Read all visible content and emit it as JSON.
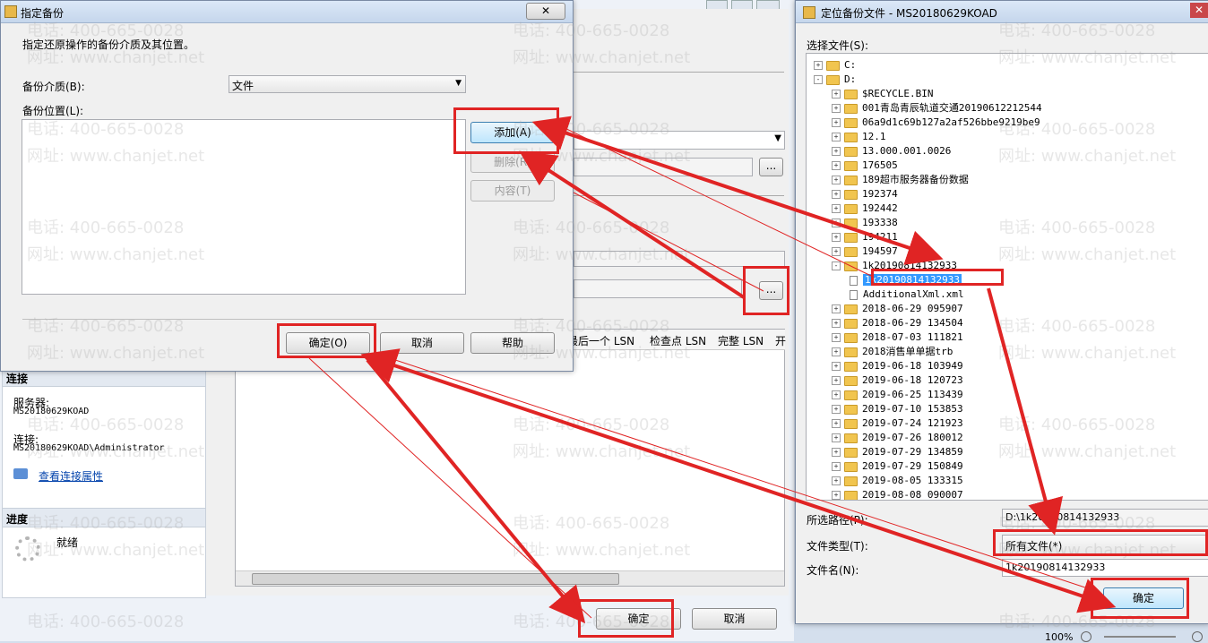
{
  "main_window": {
    "columns": [
      "最后一个 LSN",
      "检查点 LSN",
      "完整 LSN",
      "开"
    ],
    "connection_header": "连接",
    "server_label": "服务器:",
    "server_value": "MS20180629KOAD",
    "conn_label": "连接:",
    "conn_value": "MS20180629KOAD\\Administrator",
    "view_props_link": "查看连接属性",
    "progress_header": "进度",
    "progress_status": "就绪",
    "ok_label": "确定",
    "cancel_label": "取消",
    "browse_label": "..."
  },
  "dialog_specify": {
    "title": "指定备份",
    "instruction": "指定还原操作的备份介质及其位置。",
    "media_label": "备份介质(B):",
    "media_value": "文件",
    "location_label": "备份位置(L):",
    "add_label": "添加(A)",
    "remove_label": "删除(R)",
    "contents_label": "内容(T)",
    "ok_label": "确定(O)",
    "cancel_label": "取消",
    "help_label": "帮助"
  },
  "dialog_locate": {
    "title": "定位备份文件 - MS20180629KOAD",
    "select_label": "选择文件(S):",
    "tree": [
      {
        "indent": 0,
        "exp": "+",
        "type": "folder",
        "name": "C:"
      },
      {
        "indent": 0,
        "exp": "-",
        "type": "folder",
        "name": "D:"
      },
      {
        "indent": 1,
        "exp": "+",
        "type": "folder",
        "name": "$RECYCLE.BIN"
      },
      {
        "indent": 1,
        "exp": "+",
        "type": "folder",
        "name": "001青岛青辰轨道交通20190612212544"
      },
      {
        "indent": 1,
        "exp": "+",
        "type": "folder",
        "name": "06a9d1c69b127a2af526bbe9219be9"
      },
      {
        "indent": 1,
        "exp": "+",
        "type": "folder",
        "name": "12.1"
      },
      {
        "indent": 1,
        "exp": "+",
        "type": "folder",
        "name": "13.000.001.0026"
      },
      {
        "indent": 1,
        "exp": "+",
        "type": "folder",
        "name": "176505"
      },
      {
        "indent": 1,
        "exp": "+",
        "type": "folder",
        "name": "189超市服务器备份数据"
      },
      {
        "indent": 1,
        "exp": "+",
        "type": "folder",
        "name": "192374"
      },
      {
        "indent": 1,
        "exp": "+",
        "type": "folder",
        "name": "192442"
      },
      {
        "indent": 1,
        "exp": "+",
        "type": "folder",
        "name": "193338"
      },
      {
        "indent": 1,
        "exp": "+",
        "type": "folder",
        "name": "194211"
      },
      {
        "indent": 1,
        "exp": "+",
        "type": "folder",
        "name": "194597"
      },
      {
        "indent": 1,
        "exp": "-",
        "type": "folder",
        "name": "1k20190814132933"
      },
      {
        "indent": 2,
        "exp": "",
        "type": "file",
        "name": "1k20190814132933",
        "selected": true
      },
      {
        "indent": 2,
        "exp": "",
        "type": "file",
        "name": "AdditionalXml.xml"
      },
      {
        "indent": 1,
        "exp": "+",
        "type": "folder",
        "name": "2018-06-29 095907"
      },
      {
        "indent": 1,
        "exp": "+",
        "type": "folder",
        "name": "2018-06-29 134504"
      },
      {
        "indent": 1,
        "exp": "+",
        "type": "folder",
        "name": "2018-07-03 111821"
      },
      {
        "indent": 1,
        "exp": "+",
        "type": "folder",
        "name": "2018消售单单据trb"
      },
      {
        "indent": 1,
        "exp": "+",
        "type": "folder",
        "name": "2019-06-18 103949"
      },
      {
        "indent": 1,
        "exp": "+",
        "type": "folder",
        "name": "2019-06-18 120723"
      },
      {
        "indent": 1,
        "exp": "+",
        "type": "folder",
        "name": "2019-06-25 113439"
      },
      {
        "indent": 1,
        "exp": "+",
        "type": "folder",
        "name": "2019-07-10 153853"
      },
      {
        "indent": 1,
        "exp": "+",
        "type": "folder",
        "name": "2019-07-24 121923"
      },
      {
        "indent": 1,
        "exp": "+",
        "type": "folder",
        "name": "2019-07-26 180012"
      },
      {
        "indent": 1,
        "exp": "+",
        "type": "folder",
        "name": "2019-07-29 134859"
      },
      {
        "indent": 1,
        "exp": "+",
        "type": "folder",
        "name": "2019-07-29 150849"
      },
      {
        "indent": 1,
        "exp": "+",
        "type": "folder",
        "name": "2019-08-05 133315"
      },
      {
        "indent": 1,
        "exp": "+",
        "type": "folder",
        "name": "2019-08-08 090007"
      }
    ],
    "path_label": "所选路径(P):",
    "path_value": "D:\\1k20190814132933",
    "type_label": "文件类型(T):",
    "type_value": "所有文件(*)",
    "name_label": "文件名(N):",
    "name_value": "1k20190814132933",
    "ok_label": "确定",
    "zoom": "100%"
  },
  "watermark": {
    "phone": "电话: 400-665-0028",
    "site": "网址: www.chanjet.net"
  },
  "colors": {
    "annotation_red": "#e02424",
    "selection_blue": "#3399ff",
    "link_blue": "#0645ad"
  }
}
